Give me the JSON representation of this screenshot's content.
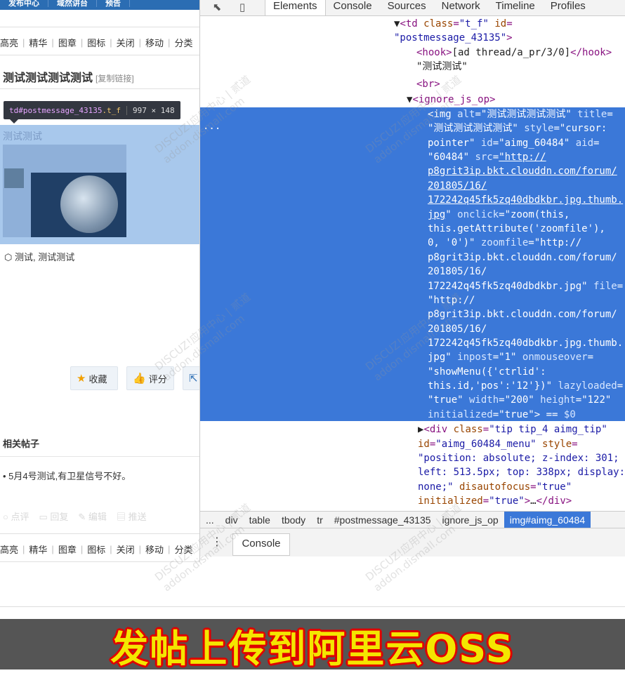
{
  "forum": {
    "topnav": [
      "发布中心",
      "域然讲台",
      "预告"
    ],
    "actionbar": [
      "高亮",
      "精华",
      "图章",
      "图标",
      "关闭",
      "移动",
      "分类"
    ],
    "post_title": "测试测试测试测试",
    "copy_link": "[复制链接]",
    "tooltip": {
      "tag": "td",
      "id": "#postmessage_43135",
      "cls": ".t_f",
      "size": "997 × 148"
    },
    "post_inner_title": "测试测试",
    "tags": "测试, 测试测试",
    "favorite_label": "收藏",
    "rate_label": "评分",
    "related_title": "相关帖子",
    "related_items": [
      "• 5月4号测试,有卫星信号不好。"
    ],
    "reply_actions": [
      "点评",
      "回复",
      "编辑",
      "推送"
    ]
  },
  "devtools": {
    "tabs": [
      "Elements",
      "Console",
      "Sources",
      "Network",
      "Timeline",
      "Profiles"
    ],
    "active_tab": "Elements",
    "breadcrumb": [
      "...",
      "div",
      "table",
      "tbody",
      "tr",
      "#postmessage_43135",
      "ignore_js_op",
      "img#aimg_60484"
    ],
    "drawer_tab": "Console",
    "ellipsis": "..."
  },
  "banner": {
    "text": "发帖上传到阿里云OSS"
  },
  "watermark": {
    "text": "DISCUZ!应用中心 | 贰道",
    "sub": "addon.dismall.com"
  },
  "colors": {
    "selection": "#3b78d8",
    "banner_text": "#f4e600",
    "banner_outline": "#e00000"
  }
}
